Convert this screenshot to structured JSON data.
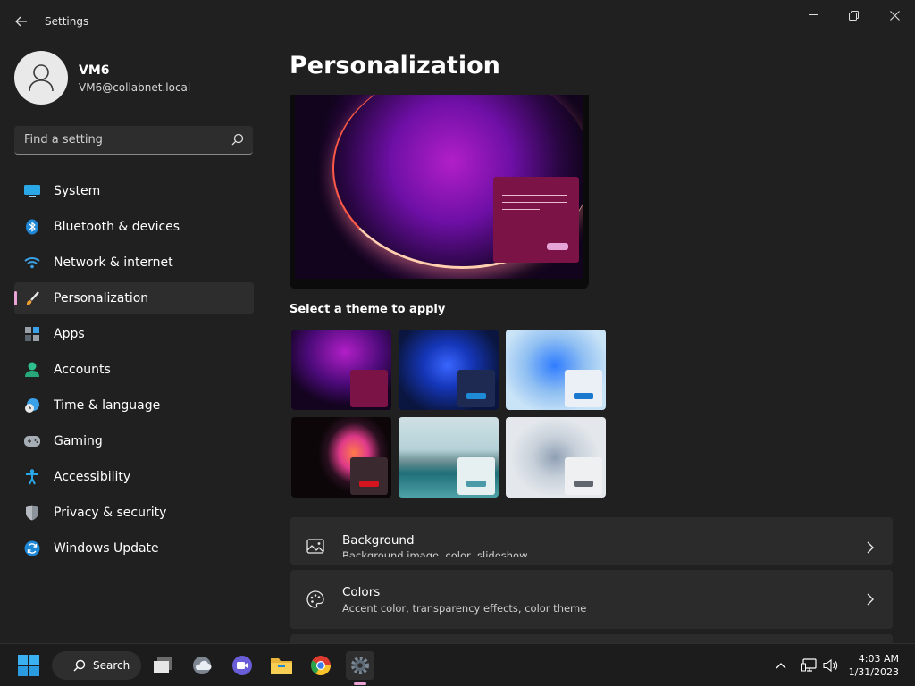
{
  "window": {
    "title": "Settings"
  },
  "profile": {
    "name": "VM6",
    "email": "VM6@collabnet.local"
  },
  "search": {
    "placeholder": "Find a setting"
  },
  "sidebar": {
    "items": [
      {
        "label": "System",
        "icon": "system-icon"
      },
      {
        "label": "Bluetooth & devices",
        "icon": "bluetooth-icon"
      },
      {
        "label": "Network & internet",
        "icon": "wifi-icon"
      },
      {
        "label": "Personalization",
        "icon": "brush-icon",
        "active": true
      },
      {
        "label": "Apps",
        "icon": "apps-icon"
      },
      {
        "label": "Accounts",
        "icon": "accounts-icon"
      },
      {
        "label": "Time & language",
        "icon": "clock-globe-icon"
      },
      {
        "label": "Gaming",
        "icon": "gamepad-icon"
      },
      {
        "label": "Accessibility",
        "icon": "accessibility-icon"
      },
      {
        "label": "Privacy & security",
        "icon": "shield-icon"
      },
      {
        "label": "Windows Update",
        "icon": "update-icon"
      }
    ]
  },
  "main": {
    "title": "Personalization",
    "theme_heading": "Select a theme to apply",
    "cards": [
      {
        "title": "Background",
        "subtitle": "Background image, color, slideshow",
        "icon": "image-icon"
      },
      {
        "title": "Colors",
        "subtitle": "Accent color, transparency effects, color theme",
        "icon": "palette-icon"
      }
    ]
  },
  "taskbar": {
    "search_label": "Search",
    "time": "4:03 AM",
    "date": "1/31/2023"
  },
  "colors": {
    "accent": "#e9a3d4",
    "background": "#202020",
    "card": "#2b2b2b"
  }
}
